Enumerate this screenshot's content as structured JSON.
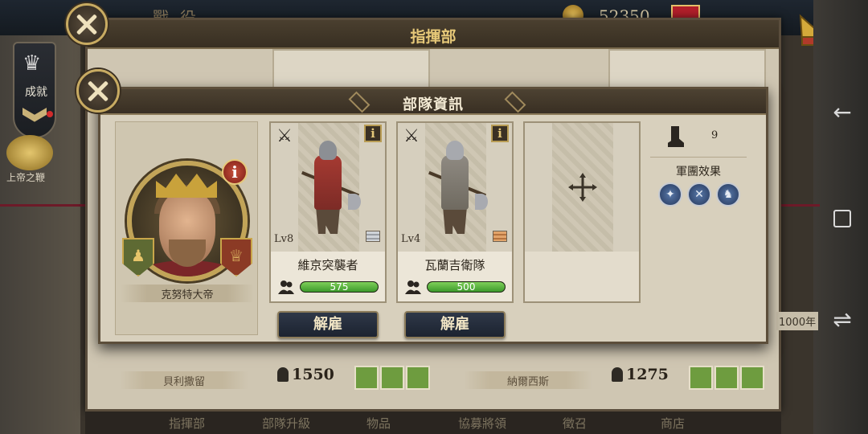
{
  "topbar": {
    "dim_title": "戰役",
    "gold": "52350"
  },
  "sidebar": {
    "achievement_label": "成就",
    "god_whip_label": "上帝之鞭"
  },
  "outer_panel": {
    "title": "指揮部",
    "left_commander_name": "貝利撒留",
    "left_power": "1550",
    "right_commander_name": "納爾西斯",
    "right_power": "1275",
    "year_label": "1000年"
  },
  "bottom_tabs": [
    "指揮部",
    "部隊升級",
    "物品",
    "協募將領",
    "徵召",
    "商店"
  ],
  "modal": {
    "title": "部隊資訊",
    "commander": {
      "name": "克努特大帝"
    },
    "units": [
      {
        "name": "維京突襲者",
        "level": "Lv8",
        "count": "575",
        "fill": 1.0,
        "rank": "silver"
      },
      {
        "name": "瓦蘭吉衛隊",
        "level": "Lv4",
        "count": "500",
        "fill": 1.0,
        "rank": "bronze"
      }
    ],
    "dismiss_label": "解雇",
    "speed": "9",
    "army_effect_label": "軍團效果",
    "icons": {
      "close": "close-icon",
      "info": "i",
      "plus": "+",
      "swords": "⚔"
    }
  },
  "colors": {
    "hp_green": "#4fb53a",
    "header_brown": "#3d3326",
    "gold_text": "#e6c878"
  }
}
